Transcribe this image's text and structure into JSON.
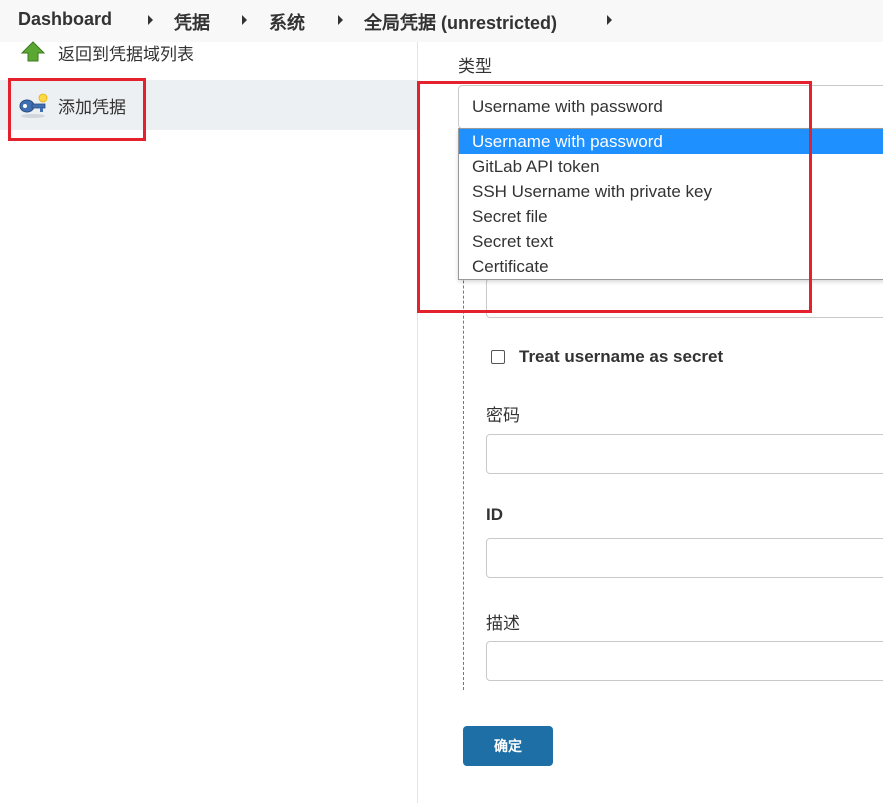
{
  "breadcrumb": {
    "items": [
      "Dashboard",
      "凭据",
      "系统",
      "全局凭据 (unrestricted)"
    ]
  },
  "sidebar": {
    "items": [
      {
        "label": "返回到凭据域列表",
        "icon": "up-arrow-icon"
      },
      {
        "label": "添加凭据",
        "icon": "key-icon"
      }
    ]
  },
  "form": {
    "kind_label": "类型",
    "kind_selected": "Username with password",
    "kind_options": [
      "Username with password",
      "GitLab API token",
      "SSH Username with private key",
      "Secret file",
      "Secret text",
      "Certificate"
    ],
    "treat_username_label": "Treat username as secret",
    "password_label": "密码",
    "id_label": "ID",
    "description_label": "描述",
    "submit_label": "确定"
  },
  "colors": {
    "highlight_box": "#e3222e",
    "selected_option": "#1e90ff",
    "submit_button": "#1d6fa5"
  }
}
